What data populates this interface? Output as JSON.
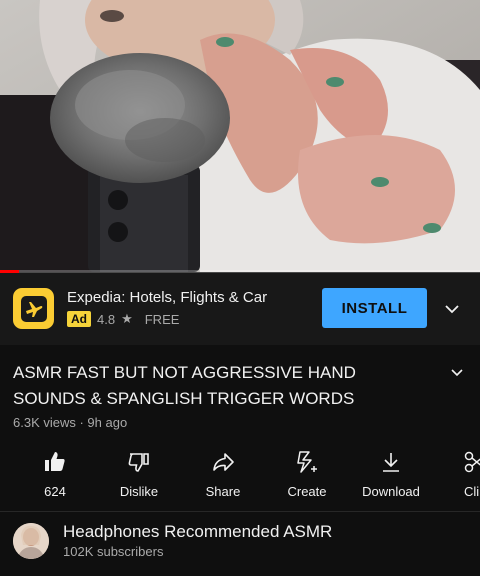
{
  "player": {
    "progress_fraction": 0.04,
    "progress_color": "#ff0000"
  },
  "ad": {
    "app_name": "Expedia: Hotels, Flights & Car",
    "badge": "Ad",
    "rating": "4.8",
    "rating_icon": "star-icon",
    "price": "FREE",
    "install_label": "INSTALL",
    "install_color": "#3ea6ff",
    "icon": "expedia-plane-icon"
  },
  "video": {
    "title": "ASMR FAST BUT NOT AGGRESSIVE HAND SOUNDS & SPANGLISH TRIGGER WORDS",
    "meta": "6.3K views · 9h ago"
  },
  "actions": [
    {
      "label": "624",
      "icon": "thumbs-up-icon"
    },
    {
      "label": "Dislike",
      "icon": "thumbs-down-icon"
    },
    {
      "label": "Share",
      "icon": "share-icon"
    },
    {
      "label": "Create",
      "icon": "create-sparkle-icon"
    },
    {
      "label": "Download",
      "icon": "download-icon"
    },
    {
      "label": "Cli",
      "icon": "scissors-icon"
    }
  ],
  "channel": {
    "name": "Headphones Recommended ASMR",
    "subscribers": "102K subscribers"
  }
}
